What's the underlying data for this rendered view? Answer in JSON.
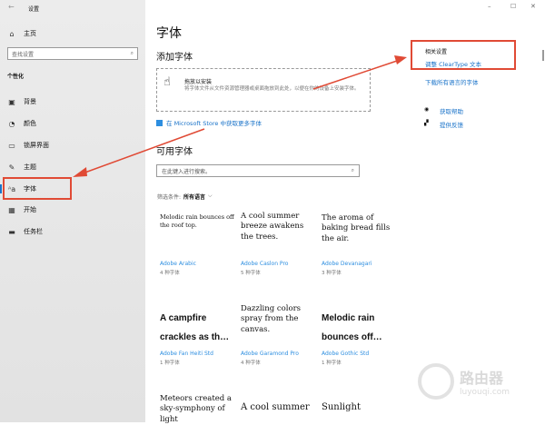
{
  "window": {
    "title": "设置",
    "back": "←",
    "minimize": "–",
    "maximize": "☐",
    "close": "✕"
  },
  "sidebar": {
    "home": "主页",
    "search_placeholder": "查找设置",
    "section": "个性化",
    "items": [
      {
        "label": "背景",
        "icon": "image-icon"
      },
      {
        "label": "颜色",
        "icon": "palette-icon"
      },
      {
        "label": "锁屏界面",
        "icon": "lock-screen-icon"
      },
      {
        "label": "主题",
        "icon": "theme-icon"
      },
      {
        "label": "字体",
        "icon": "font-icon"
      },
      {
        "label": "开始",
        "icon": "start-icon"
      },
      {
        "label": "任务栏",
        "icon": "taskbar-icon"
      }
    ]
  },
  "main": {
    "title": "字体",
    "add_heading": "添加字体",
    "drop_title": "拖放以安装",
    "drop_desc": "将字体文件从文件资源管理器或桌面拖放到此处，以便在你的设备上安装字体。",
    "store_link": "在 Microsoft Store 中获取更多字体",
    "available_heading": "可用字体",
    "search_placeholder": "在此键入进行搜索。",
    "filter_label": "筛选条件:",
    "filter_value": "所有语言",
    "fonts": [
      {
        "sample": "Melodic rain bounces off the roof top.",
        "name": "Adobe Arabic",
        "count": "4 种字体"
      },
      {
        "sample": "A cool summer breeze awakens the trees.",
        "name": "Adobe Caslon Pro",
        "count": "5 种字体"
      },
      {
        "sample": "The aroma of baking bread fills the air.",
        "name": "Adobe Devanagari",
        "count": "3 种字体"
      },
      {
        "sample": "A campfire crackles as th…",
        "name": "Adobe Fan Heiti Std",
        "count": "1 种字体"
      },
      {
        "sample": "Dazzling colors spray from the canvas.",
        "name": "Adobe Garamond Pro",
        "count": "4 种字体"
      },
      {
        "sample": "Melodic rain bounces off…",
        "name": "Adobe Gothic Std",
        "count": "1 种字体"
      },
      {
        "sample": "Meteors created a sky-symphony of light",
        "name": "",
        "count": ""
      },
      {
        "sample": "A cool summer",
        "name": "",
        "count": ""
      },
      {
        "sample": "Sunlight",
        "name": "",
        "count": ""
      }
    ]
  },
  "related": {
    "heading": "相关设置",
    "cleartype": "调整 ClearType 文本",
    "download_all": "下载所有语言的字体",
    "help": "获取帮助",
    "feedback": "提供反馈"
  },
  "watermark": {
    "cn": "路由器",
    "url": "luyouqi.com"
  },
  "colors": {
    "accent": "#1a73c9",
    "highlight": "#e04a35"
  }
}
